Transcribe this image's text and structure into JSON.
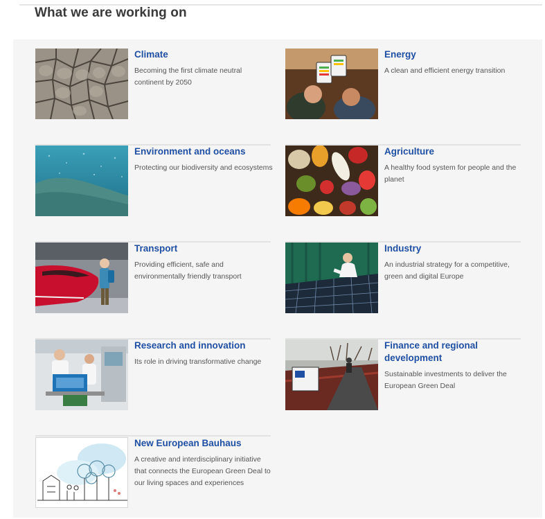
{
  "section": {
    "heading": "What we are working on"
  },
  "cards": [
    {
      "title": "Climate",
      "description": "Becoming the first climate neutral continent by 2050",
      "image": "cracked-earth-image"
    },
    {
      "title": "Energy",
      "description": "A clean and efficient energy transition",
      "image": "energy-tablet-image"
    },
    {
      "title": "Environment and oceans",
      "description": "Protecting our biodiversity and ecosystems",
      "image": "ocean-image"
    },
    {
      "title": "Agriculture",
      "description": "A healthy food system for people and the planet",
      "image": "vegetables-image"
    },
    {
      "title": "Transport",
      "description": "Providing efficient, safe and environmentally friendly transport",
      "image": "train-image"
    },
    {
      "title": "Industry",
      "description": "An industrial strategy for a competitive, green and digital Europe",
      "image": "solar-panel-image"
    },
    {
      "title": "Research and innovation",
      "description": "Its role in driving transformative change",
      "image": "laboratory-image"
    },
    {
      "title": "Finance and regional development",
      "description": "Sustainable investments to deliver the European Green Deal",
      "image": "bridge-image"
    },
    {
      "title": "New European Bauhaus",
      "description": "A creative and interdisciplinary initiative that connects the European Green Deal to our living spaces and experiences",
      "image": "bauhaus-sketch-image"
    }
  ]
}
